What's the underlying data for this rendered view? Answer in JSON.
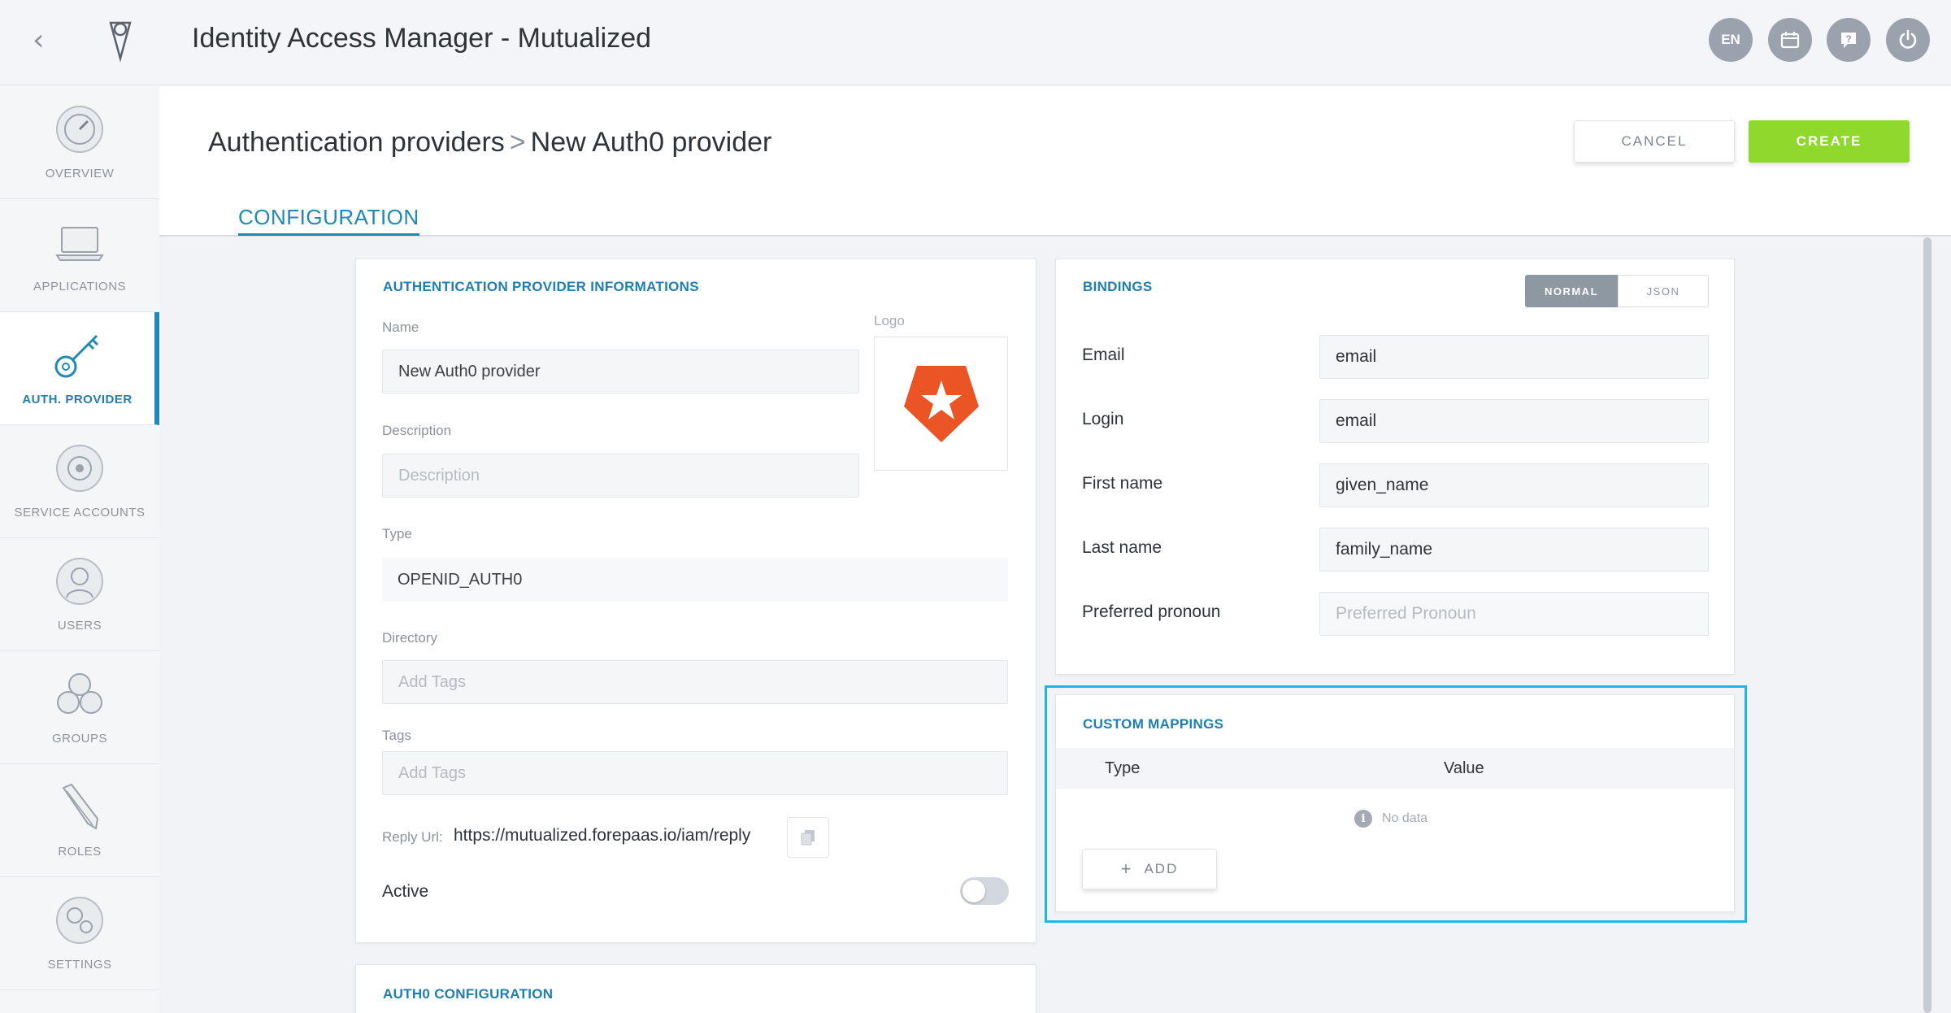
{
  "app": {
    "title": "Identity Access Manager - Mutualized",
    "lang_label": "EN"
  },
  "sidebar": {
    "items": [
      {
        "label": "OVERVIEW",
        "icon": "speedometer-icon"
      },
      {
        "label": "APPLICATIONS",
        "icon": "laptop-icon"
      },
      {
        "label": "AUTH. PROVIDER",
        "icon": "key-icon",
        "active": true
      },
      {
        "label": "SERVICE ACCOUNTS",
        "icon": "service-account-icon"
      },
      {
        "label": "USERS",
        "icon": "user-icon"
      },
      {
        "label": "GROUPS",
        "icon": "group-icon"
      },
      {
        "label": "ROLES",
        "icon": "pencil-icon"
      },
      {
        "label": "SETTINGS",
        "icon": "gears-icon"
      }
    ]
  },
  "header": {
    "breadcrumb_parent": "Authentication providers",
    "breadcrumb_separator": ">",
    "breadcrumb_current": "New Auth0 provider",
    "cancel_label": "CANCEL",
    "create_label": "CREATE",
    "tab_label": "CONFIGURATION"
  },
  "provider_info": {
    "title": "AUTHENTICATION PROVIDER INFORMATIONS",
    "name_label": "Name",
    "name_value": "New Auth0 provider",
    "logo_label": "Logo",
    "description_label": "Description",
    "description_placeholder": "Description",
    "type_label": "Type",
    "type_value": "OPENID_AUTH0",
    "directory_label": "Directory",
    "directory_placeholder": "Add Tags",
    "tags_label": "Tags",
    "tags_placeholder": "Add Tags",
    "reply_url_label": "Reply Url:",
    "reply_url_value": "https://mutualized.forepaas.io/iam/reply",
    "active_label": "Active",
    "active": false
  },
  "bindings": {
    "title": "BINDINGS",
    "mode_normal": "NORMAL",
    "mode_json": "JSON",
    "rows": [
      {
        "label": "Email",
        "value": "email",
        "placeholder": ""
      },
      {
        "label": "Login",
        "value": "email",
        "placeholder": ""
      },
      {
        "label": "First name",
        "value": "given_name",
        "placeholder": ""
      },
      {
        "label": "Last name",
        "value": "family_name",
        "placeholder": ""
      },
      {
        "label": "Preferred pronoun",
        "value": "",
        "placeholder": "Preferred Pronoun"
      }
    ]
  },
  "custom_mappings": {
    "title": "CUSTOM MAPPINGS",
    "col_type": "Type",
    "col_value": "Value",
    "no_data": "No data",
    "add_label": "ADD"
  },
  "auth0_config": {
    "title": "AUTH0 CONFIGURATION"
  },
  "colors": {
    "accent": "#1e8ab5",
    "create": "#8fd92d",
    "highlight": "#1fb6e4",
    "auth0_logo": "#eb5424"
  }
}
